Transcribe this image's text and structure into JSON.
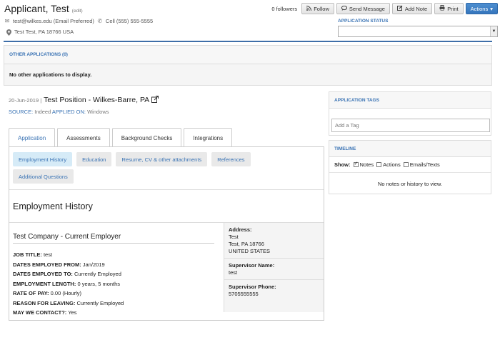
{
  "header": {
    "name": "Applicant, Test",
    "edit": "(edit)",
    "email": "test@wilkes.edu (Email Preferred)",
    "cell": "Cell (555) 555-5555",
    "address": "Test Test, PA 18766 USA"
  },
  "actions": {
    "followers": "0 followers",
    "follow": "Follow",
    "send_message": "Send Message",
    "add_note": "Add Note",
    "print": "Print",
    "actions": "Actions"
  },
  "status": {
    "label": "APPLICATION STATUS",
    "value": ""
  },
  "other_apps": {
    "title": "OTHER APPLICATIONS (0)",
    "empty": "No other applications to display."
  },
  "job": {
    "date": "20-Jun-2019 |",
    "title": "Test Position - Wilkes-Barre, PA",
    "source_label": "SOURCE:",
    "source": "Indeed",
    "applied_label": "APPLIED ON:",
    "applied": "Windows"
  },
  "tabs": [
    "Application",
    "Assessments",
    "Background Checks",
    "Integrations"
  ],
  "subtabs": [
    "Employment History",
    "Education",
    "Resume, CV & other attachments",
    "References",
    "Additional Questions"
  ],
  "section_title": "Employment History",
  "employer": {
    "name": "Test Company - Current Employer",
    "fields": [
      {
        "label": "JOB TITLE:",
        "value": "test"
      },
      {
        "label": "DATES EMPLOYED FROM:",
        "value": "Jan/2019"
      },
      {
        "label": "DATES EMPLOYED TO:",
        "value": "Currently Employed"
      },
      {
        "label": "EMPLOYMENT LENGTH:",
        "value": "0 years, 5 months"
      },
      {
        "label": "RATE OF PAY:",
        "value": "0.00 (Hourly)"
      },
      {
        "label": "REASON FOR LEAVING:",
        "value": "Currently Employed"
      },
      {
        "label": "MAY WE CONTACT?:",
        "value": "Yes"
      }
    ],
    "address_label": "Address:",
    "address_lines": [
      "Test",
      "Test, PA 18766",
      "UNITED STATES"
    ],
    "supervisor_label": "Supervisor Name:",
    "supervisor": "test",
    "phone_label": "Supervisor Phone:",
    "phone": "5705555555"
  },
  "tags": {
    "title": "APPLICATION TAGS",
    "placeholder": "Add a Tag"
  },
  "timeline": {
    "title": "TIMELINE",
    "show": "Show:",
    "notes": "Notes",
    "actions": "Actions",
    "emails": "Emails/Texts",
    "empty": "No notes or history to view."
  }
}
